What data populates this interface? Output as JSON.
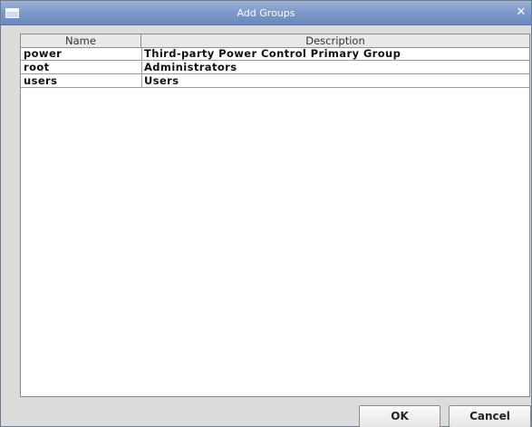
{
  "window": {
    "title": "Add Groups",
    "close_glyph": "✕"
  },
  "table": {
    "columns": [
      "Name",
      "Description"
    ],
    "rows": [
      {
        "name": "power",
        "description": "Third-party Power Control Primary Group"
      },
      {
        "name": "root",
        "description": "Administrators"
      },
      {
        "name": "users",
        "description": "Users"
      }
    ]
  },
  "buttons": {
    "ok": "OK",
    "cancel": "Cancel"
  },
  "icons": {
    "window_icon": "window-icon",
    "close_icon": "close-icon"
  },
  "colors": {
    "titlebar": "#7f9bcb",
    "dialog_bg": "#dcdcdc"
  }
}
